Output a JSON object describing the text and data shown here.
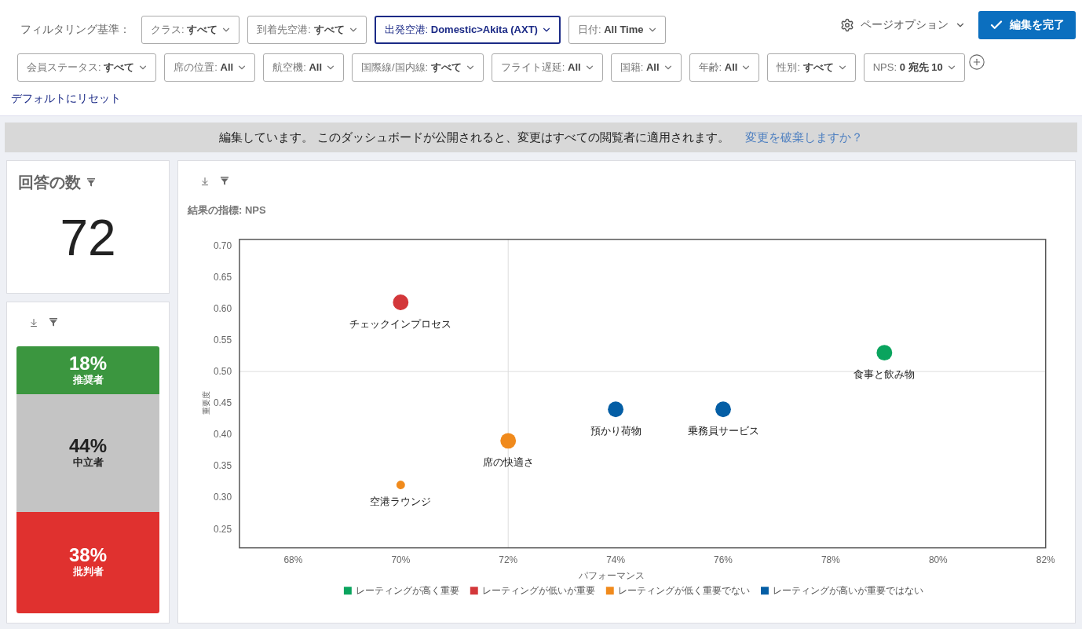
{
  "filter_bar": {
    "label": "フィルタリング基準：",
    "rows": [
      {
        "filters": [
          {
            "label": "クラス:",
            "value": "すべて",
            "selected": false
          },
          {
            "label": "到着先空港:",
            "value": "すべて",
            "selected": false
          },
          {
            "label": "出発空港:",
            "value": "Domestic>Akita (AXT)",
            "selected": true
          },
          {
            "label": "日付:",
            "value": "All Time",
            "selected": false
          }
        ]
      },
      {
        "filters": [
          {
            "label": "会員ステータス:",
            "value": "すべて",
            "selected": false
          },
          {
            "label": "席の位置:",
            "value": "All",
            "selected": false
          },
          {
            "label": "航空機:",
            "value": "All",
            "selected": false
          },
          {
            "label": "国際線/国内線:",
            "value": "すべて",
            "selected": false
          },
          {
            "label": "フライト遅延:",
            "value": "All",
            "selected": false
          },
          {
            "label": "国籍:",
            "value": "All",
            "selected": false
          },
          {
            "label": "年齢:",
            "value": "All",
            "selected": false
          },
          {
            "label": "性別:",
            "value": "すべて",
            "selected": false
          },
          {
            "label": "NPS:",
            "value": "0 宛先 10",
            "selected": false
          }
        ]
      }
    ],
    "page_options": "ページオプション",
    "done_button": "編集を完了",
    "reset_link": "デフォルトにリセット"
  },
  "banner": {
    "message": "編集しています。 このダッシュボードが公開されると、変更はすべての閲覧者に適用されます。",
    "link": "変更を破棄しますか？"
  },
  "response_count": {
    "title": "回答の数",
    "value": "72"
  },
  "nps_breakdown": {
    "segments": [
      {
        "kind": "promoter",
        "percent": "18%",
        "label": "推奨者",
        "color": "#3b963f"
      },
      {
        "kind": "passive",
        "percent": "44%",
        "label": "中立者",
        "color": "#c4c4c4"
      },
      {
        "kind": "detractor",
        "percent": "38%",
        "label": "批判者",
        "color": "#e0312f"
      }
    ]
  },
  "driver_chart": {
    "metric": "結果の指標: NPS",
    "chart_data": {
      "type": "scatter",
      "xlabel": "パフォーマンス",
      "ylabel": "重要度",
      "xlim": [
        67,
        82
      ],
      "ylim": [
        0.22,
        0.71
      ],
      "xticks": [
        {
          "value": 68,
          "label": "68%"
        },
        {
          "value": 70,
          "label": "70%"
        },
        {
          "value": 72,
          "label": "72%"
        },
        {
          "value": 74,
          "label": "74%"
        },
        {
          "value": 76,
          "label": "76%"
        },
        {
          "value": 78,
          "label": "78%"
        },
        {
          "value": 80,
          "label": "80%"
        },
        {
          "value": 82,
          "label": "82%"
        }
      ],
      "yticks": [
        {
          "value": 0.7,
          "label": "0.70"
        },
        {
          "value": 0.65,
          "label": "0.65"
        },
        {
          "value": 0.6,
          "label": "0.60"
        },
        {
          "value": 0.55,
          "label": "0.55"
        },
        {
          "value": 0.5,
          "label": "0.50"
        },
        {
          "value": 0.45,
          "label": "0.45"
        },
        {
          "value": 0.4,
          "label": "0.40"
        },
        {
          "value": 0.35,
          "label": "0.35"
        },
        {
          "value": 0.3,
          "label": "0.30"
        },
        {
          "value": 0.25,
          "label": "0.25"
        }
      ],
      "legend": "bottom",
      "ref_lines": [
        {
          "axis": "x",
          "value": 72
        },
        {
          "axis": "y",
          "value": 0.5
        }
      ],
      "annotations": [
        "食事と飲み物",
        "チェックインプロセス",
        "席の快適さ",
        "空港ラウンジ",
        "預かり荷物",
        "乗務員サービス"
      ],
      "series": [
        {
          "name": "レーティングが高く重要",
          "color": "#0aa45e",
          "x": [
            79
          ],
          "values": [
            0.53
          ]
        },
        {
          "name": "レーティングが低いが重要",
          "color": "#d3373a",
          "x": [
            70
          ],
          "values": [
            0.61
          ]
        },
        {
          "name": "レーティングが低く重要でない",
          "color": "#f08a1c",
          "x": [
            72,
            70
          ],
          "values": [
            0.39,
            0.32
          ]
        },
        {
          "name": "レーティングが高いが重要ではない",
          "color": "#045ea5",
          "x": [
            74,
            76
          ],
          "values": [
            0.44,
            0.44
          ]
        }
      ]
    }
  }
}
